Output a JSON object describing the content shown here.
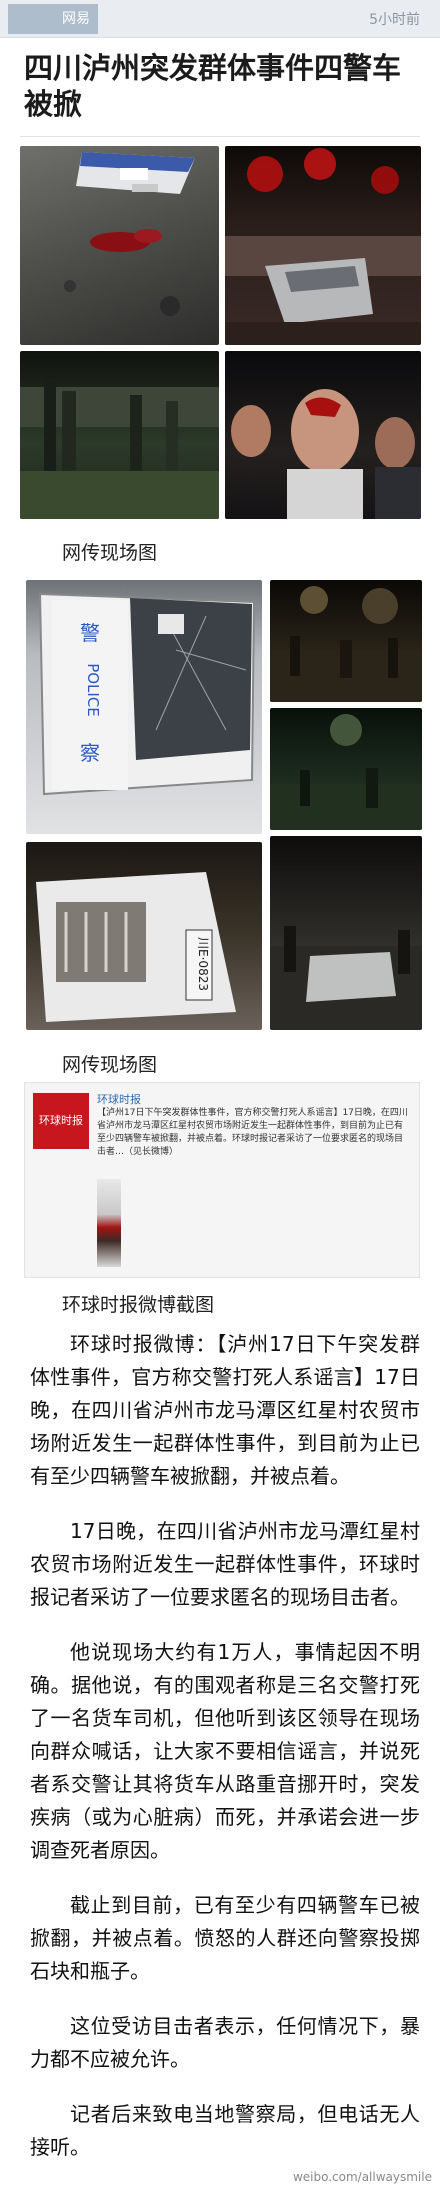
{
  "header": {
    "source": "网易",
    "time": "5小时前"
  },
  "article": {
    "title": "四川泸州突发群体事件四警车被掀",
    "captions": [
      "网传现场图",
      "网传现场图",
      "环球时报微博截图"
    ],
    "weibo_shot": {
      "account": "环球时报",
      "logo_text": "环球时报",
      "text": "【泸州17日下午突发群体性事件，官方称交警打死人系谣言】17日晚，在四川省泸州市龙马潭区红星村农贸市场附近发生一起群体性事件，到目前为止已有至少四辆警车被掀翻，并被点着。环球时报记者采访了一位要求匿名的现场目击者…（见长微博）",
      "police_text": "警 POLICE 察",
      "plate_text": "川E·0823"
    },
    "paragraphs": [
      "环球时报微博：【泸州17日下午突发群体性事件，官方称交警打死人系谣言】17日晚，在四川省泸州市龙马潭区红星村农贸市场附近发生一起群体性事件，到目前为止已有至少四辆警车被掀翻，并被点着。",
      "17日晚，在四川省泸州市龙马潭红星村农贸市场附近发生一起群体性事件，环球时报记者采访了一位要求匿名的现场目击者。",
      "他说现场大约有1万人，事情起因不明确。据他说，有的围观者称是三名交警打死了一名货车司机，但他听到该区领导在现场向群众喊话，让大家不要相信谣言，并说死者系交警让其将货车从路重音挪开时，突发疾病（或为心脏病）而死，并承诺会进一步调查死者原因。",
      "截止到目前，已有至少有四辆警车已被掀翻，并被点着。愤怒的人群还向警察投掷石块和瓶子。",
      "这位受访目击者表示，任何情况下，暴力都不应被允许。",
      "记者后来致电当地警察局，但电话无人接听。"
    ]
  },
  "watermark": "weibo.com/allwaysmile"
}
